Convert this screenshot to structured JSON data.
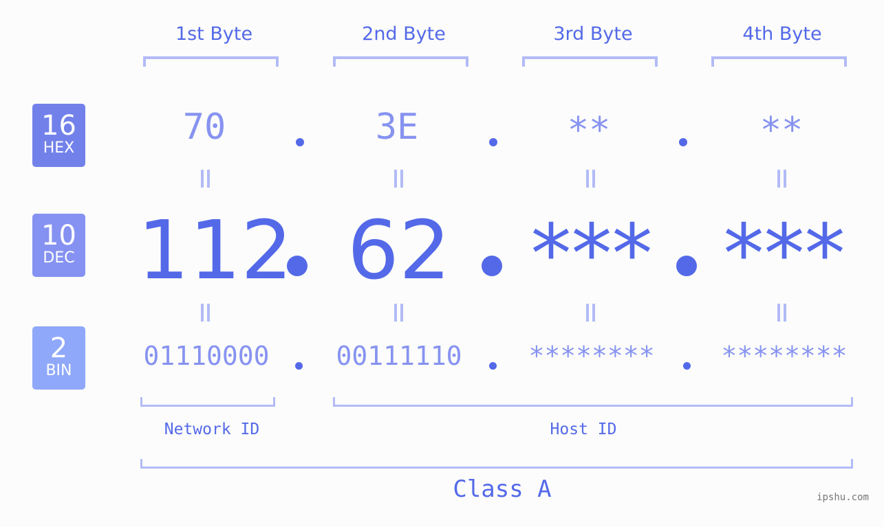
{
  "badges": [
    {
      "number": "16",
      "label": "HEX",
      "color": "#7281ea"
    },
    {
      "number": "10",
      "label": "DEC",
      "color": "#8592f1"
    },
    {
      "number": "2",
      "label": "BIN",
      "color": "#8fa8f9"
    }
  ],
  "bytes": [
    {
      "title": "1st Byte",
      "hex": "70",
      "dec": "112",
      "bin": "01110000"
    },
    {
      "title": "2nd Byte",
      "hex": "3E",
      "dec": "62",
      "bin": "00111110"
    },
    {
      "title": "3rd Byte",
      "hex": "**",
      "dec": "***",
      "bin": "********"
    },
    {
      "title": "4th Byte",
      "hex": "**",
      "dec": "***",
      "bin": "********"
    }
  ],
  "network_id_label": "Network ID",
  "host_id_label": "Host ID",
  "class_label": "Class A",
  "watermark": "ipshu.com",
  "colors": {
    "accent": "#5469e8",
    "light": "#8793f0",
    "bracket": "#b2bbf6"
  }
}
